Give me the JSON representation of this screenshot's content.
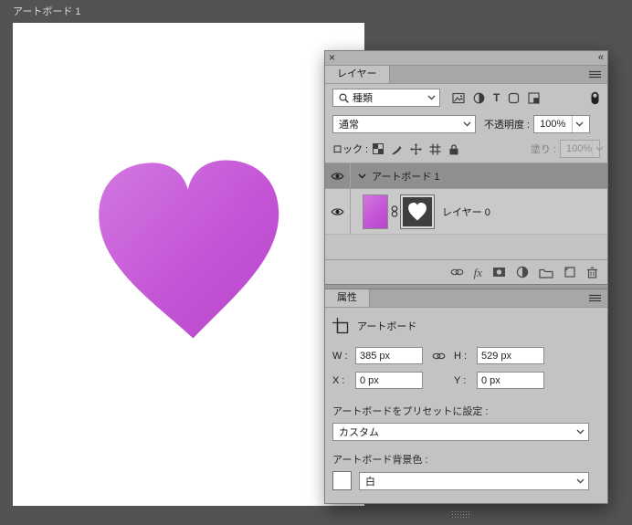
{
  "canvas": {
    "artboard_label": "アートボード 1"
  },
  "layers_panel": {
    "header": {
      "close_glyph": "×",
      "collapse_glyph": "«"
    },
    "tab_label": "レイヤー",
    "filter_row": {
      "kind_value": "種類",
      "type_filter_glyph": "T"
    },
    "blend_row": {
      "mode_value": "通常",
      "opacity_label": "不透明度 :",
      "opacity_value": "100%"
    },
    "lock_row": {
      "label": "ロック :",
      "fill_label": "塗り :",
      "fill_value": "100%"
    },
    "layers": [
      {
        "label": "アートボード 1"
      },
      {
        "label": "レイヤー 0"
      }
    ],
    "footer": {
      "fx_label": "fx"
    }
  },
  "properties_panel": {
    "tab_label": "属性",
    "object_type": "アートボード",
    "w_label": "W :",
    "w_value": "385 px",
    "h_label": "H :",
    "h_value": "529 px",
    "x_label": "X :",
    "x_value": "0 px",
    "y_label": "Y :",
    "y_value": "0 px",
    "preset_label": "アートボードをプリセットに設定 :",
    "preset_value": "カスタム",
    "bg_label": "アートボード背景色 :",
    "bg_value": "白"
  },
  "colors": {
    "workspace_bg": "#535353",
    "artboard_bg": "#ffffff",
    "heart_fill": "#c455d6",
    "panel_bg": "#c3c3c3",
    "selected_row_bg": "#8f8f8f"
  }
}
